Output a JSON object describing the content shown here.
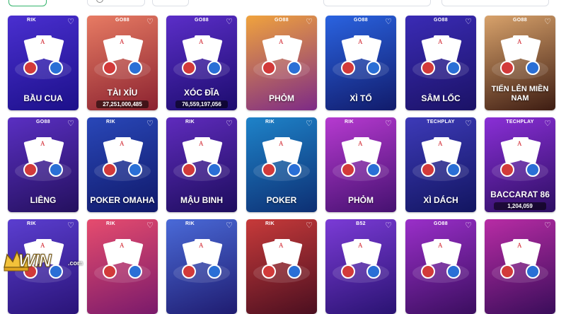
{
  "colors": {
    "heart": "#ffffff",
    "counter_bg": "#000000",
    "filter_active": "#33b36b"
  },
  "logo": {
    "main": "WIN",
    "suffix": ".com"
  },
  "cards": [
    {
      "name": "bau-cua",
      "title": "BẦU CUA",
      "brand": "RIK",
      "counter": "",
      "bg": "#4a2fd0",
      "bg2": "#1c108a"
    },
    {
      "name": "tai-xiu",
      "title": "TÀI XỈU",
      "brand": "GO88",
      "counter": "27,251,000,485",
      "bg": "#e77b63",
      "bg2": "#8b2230"
    },
    {
      "name": "xoc-dia",
      "title": "XÓC ĐĨA",
      "brand": "GO88",
      "counter": "76,559,197,056",
      "bg": "#5b2ec8",
      "bg2": "#1c0c6e"
    },
    {
      "name": "phom-go88",
      "title": "PHỎM",
      "brand": "GO88",
      "counter": "",
      "bg": "#f0a33d",
      "bg2": "#7d2a86"
    },
    {
      "name": "xi-to",
      "title": "XÌ TỐ",
      "brand": "GO88",
      "counter": "",
      "bg": "#2a63e0",
      "bg2": "#111b6b"
    },
    {
      "name": "sam-loc",
      "title": "SÂM LỐC",
      "brand": "GO88",
      "counter": "",
      "bg": "#3a2bb5",
      "bg2": "#1b1266"
    },
    {
      "name": "tien-len",
      "title": "TIẾN LÊN MIỀN NAM",
      "brand": "GO88",
      "counter": "",
      "bg": "#d8a26b",
      "bg2": "#3d1c12"
    },
    {
      "name": "lieng",
      "title": "LIÊNG",
      "brand": "GO88",
      "counter": "",
      "bg": "#5a2fc2",
      "bg2": "#24105e"
    },
    {
      "name": "poker-omaha",
      "title": "POKER OMAHA",
      "brand": "RIK",
      "counter": "",
      "bg": "#2947b8",
      "bg2": "#10196a"
    },
    {
      "name": "mau-binh",
      "title": "MẬU BINH",
      "brand": "RIK",
      "counter": "",
      "bg": "#5f2bbd",
      "bg2": "#1d0d5d"
    },
    {
      "name": "poker",
      "title": "POKER",
      "brand": "RIK",
      "counter": "",
      "bg": "#1e83c9",
      "bg2": "#0d2f73"
    },
    {
      "name": "phom-rik",
      "title": "PHỎM",
      "brand": "RIK",
      "counter": "",
      "bg": "#b63ad0",
      "bg2": "#451170"
    },
    {
      "name": "xi-dach",
      "title": "XÌ DÁCH",
      "brand": "TECHPLAY",
      "counter": "",
      "bg": "#3d3ab8",
      "bg2": "#121560"
    },
    {
      "name": "baccarat",
      "title": "BACCARAT 86",
      "brand": "TECHPLAY",
      "counter": "1,204,059",
      "bg": "#8a2fd6",
      "bg2": "#2c0e62"
    },
    {
      "name": "row3-1",
      "title": "",
      "brand": "RIK",
      "counter": "",
      "bg": "#5b3ed0",
      "bg2": "#2a1478"
    },
    {
      "name": "row3-2",
      "title": "",
      "brand": "RIK",
      "counter": "",
      "bg": "#e64c6e",
      "bg2": "#7a1a6b"
    },
    {
      "name": "row3-3",
      "title": "",
      "brand": "RIK",
      "counter": "",
      "bg": "#4a6ad8",
      "bg2": "#1f1c70"
    },
    {
      "name": "row3-4",
      "title": "",
      "brand": "RIK",
      "counter": "",
      "bg": "#c73a3a",
      "bg2": "#4b0f20"
    },
    {
      "name": "row3-5",
      "title": "",
      "brand": "B52",
      "counter": "",
      "bg": "#7b3bd6",
      "bg2": "#2a1372"
    },
    {
      "name": "row3-6",
      "title": "",
      "brand": "GO88",
      "counter": "",
      "bg": "#9a2fc9",
      "bg2": "#3b0e5f"
    },
    {
      "name": "row3-7",
      "title": "",
      "brand": "",
      "counter": "",
      "bg": "#b82ca5",
      "bg2": "#3a0d5a"
    }
  ]
}
